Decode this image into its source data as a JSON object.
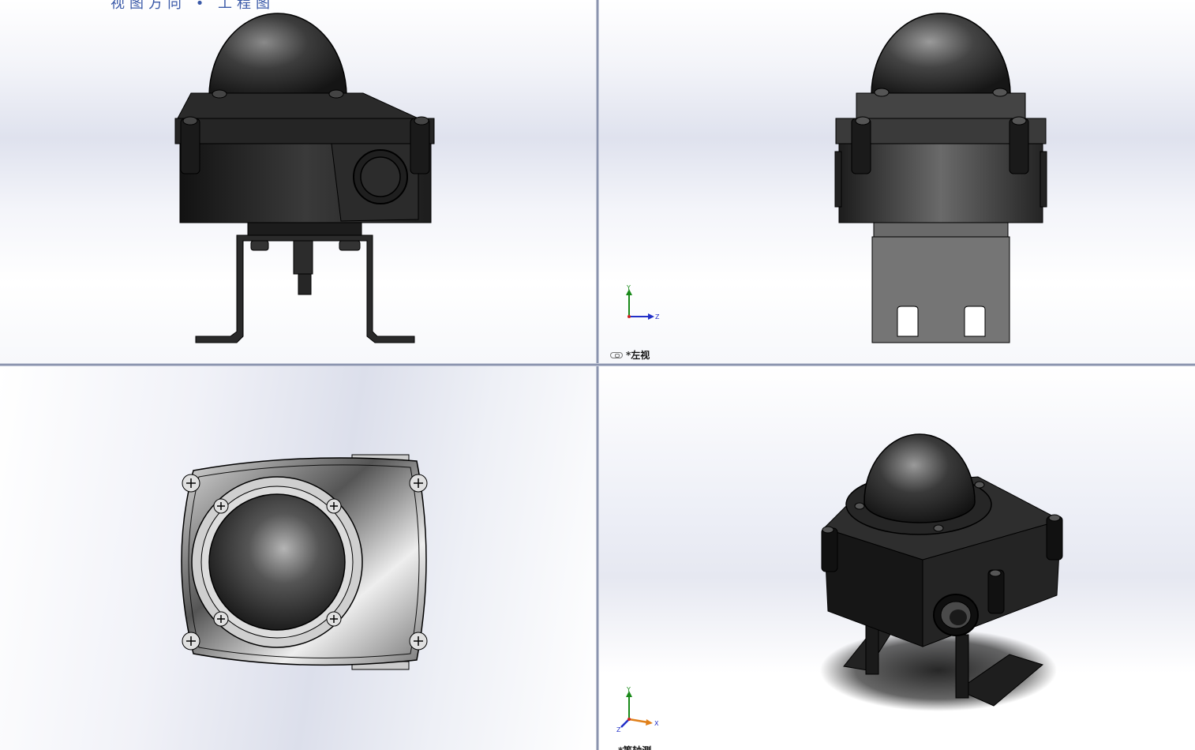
{
  "top_left": {
    "view": "front",
    "clipped_title": "视图方向 • 工程图"
  },
  "top_right": {
    "view": "left",
    "view_label": "*左视",
    "triad": {
      "x": "",
      "y": "Y",
      "z": "Z"
    }
  },
  "bottom_left": {
    "view": "top"
  },
  "bottom_right": {
    "view": "isometric",
    "view_label": "*等轴测",
    "triad": {
      "x": "X",
      "y": "Y",
      "z": "Z"
    }
  },
  "colors": {
    "viewport_bg_center": "#dfe2ee",
    "divider": "#8a93ad",
    "model_dark": "#1e1e1e",
    "triad_x": "#d02020",
    "triad_y": "#1a8a1a",
    "triad_z": "#2230c8",
    "triad_orange": "#e0801a"
  }
}
